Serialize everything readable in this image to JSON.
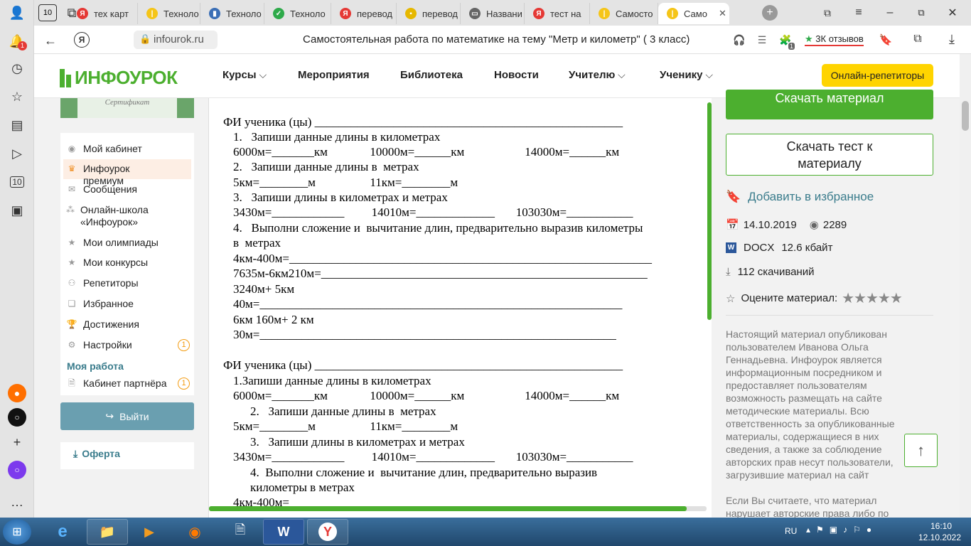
{
  "browser": {
    "tabs": [
      {
        "label": "тех карт",
        "icon": "yandex-icon",
        "color": "#e53935"
      },
      {
        "label": "Техноло",
        "icon": "infourok-tab-icon",
        "color": "#f5c518"
      },
      {
        "label": "Техноло",
        "icon": "book-icon",
        "color": "#3b6fb6"
      },
      {
        "label": "Техноло",
        "icon": "check-icon",
        "color": "#2eaa4a"
      },
      {
        "label": "перевод",
        "icon": "yandex-icon",
        "color": "#e53935"
      },
      {
        "label": "перевод",
        "icon": "image-icon",
        "color": "#e6b800"
      },
      {
        "label": "Названи",
        "icon": "doc-icon",
        "color": "#666666"
      },
      {
        "label": "тест на",
        "icon": "yandex-icon",
        "color": "#e53935"
      },
      {
        "label": "Самосто",
        "icon": "infourok-tab-icon",
        "color": "#f5c518"
      },
      {
        "label": "Само",
        "icon": "infourok-tab-icon",
        "color": "#f5c518"
      }
    ],
    "tab_count_badge": "10",
    "notif_badge": "1",
    "url": "infourok.ru",
    "page_title": "Самостоятельная работа по математике на тему \"Метр и километр\" ( 3 класс)",
    "reviews": "3К отзывов",
    "ext_badge": "1"
  },
  "site": {
    "logo": "ИНФОУРОК",
    "certificate_text": "Сертификат",
    "nav": [
      {
        "label": "Курсы",
        "dropdown": true
      },
      {
        "label": "Мероприятия",
        "dropdown": false
      },
      {
        "label": "Библиотека",
        "dropdown": false
      },
      {
        "label": "Новости",
        "dropdown": false
      },
      {
        "label": "Учителю",
        "dropdown": true
      },
      {
        "label": "Ученику",
        "dropdown": true
      }
    ],
    "tutors_button": "Онлайн-репетиторы",
    "accent": "#4caf2f",
    "tutors_color": "#ffd400"
  },
  "sidebar": {
    "items": [
      {
        "label": "Мой кабинет",
        "icon": "user-icon"
      },
      {
        "label": "Инфоурок премиум",
        "icon": "crown-icon"
      },
      {
        "label": "Сообщения",
        "icon": "mail-icon"
      },
      {
        "label": "Онлайн-школа «Инфоурок»",
        "icon": "school-icon"
      },
      {
        "label": "Мои олимпиады",
        "icon": "star-icon"
      },
      {
        "label": "Мои конкурсы",
        "icon": "star-icon"
      },
      {
        "label": "Репетиторы",
        "icon": "people-icon"
      },
      {
        "label": "Избранное",
        "icon": "bookmark-icon"
      },
      {
        "label": "Достижения",
        "icon": "trophy-icon"
      },
      {
        "label": "Настройки",
        "icon": "gear-icon",
        "badge": "1"
      }
    ],
    "section_title": "Моя работа",
    "partner": {
      "label": "Кабинет партнёра",
      "badge": "1"
    },
    "logout": "Выйти",
    "offer": "Оферта"
  },
  "document": {
    "lines": [
      "ФИ ученика (цы) ___________________________________________________",
      "1.   Запиши данные длины в километрах",
      "6000м=_______км              10000м=______км                    14000м=______км",
      "2.   Запиши данные длины в  метрах",
      "5км=________м                  11км=________м",
      "3.   Запиши длины в километрах и метрах",
      "3430м=____________         14010м=_____________       103030м=___________",
      "4.   Выполни сложение и  вычитание длин, предварительно выразив километры",
      "в  метрах",
      "4км-400м=____________________________________________________________",
      "7635м-6км210м=______________________________________________________",
      "3240м+ 5км",
      "40м=____________________________________________________________",
      "6км 160м+ 2 км",
      "30м=___________________________________________________________",
      "ФИ ученика (цы) ___________________________________________________",
      "1.Запиши данные длины в километрах",
      "6000м=_______км              10000м=______км                    14000м=______км",
      "2.   Запиши данные длины в  метрах",
      "5км=________м                  11км=________м",
      "3.   Запиши длины в километрах и метрах",
      "3430м=____________         14010м=_____________       103030м=___________",
      "4.  Выполни сложение и  вычитание длин, предварительно выразив",
      "километры в метрах",
      "4км-400м="
    ]
  },
  "right": {
    "download_button": "Скачать материал",
    "download_test": "Скачать тест к материалу",
    "favorite": "Добавить в избранное",
    "date": "14.10.2019",
    "views": "2289",
    "format": "DOCX",
    "size": "12.6 кбайт",
    "downloads": "112 скачиваний",
    "rate": "Оцените материал:",
    "disclaimer": "Настоящий материал опубликован пользователем Иванова Ольга Геннадьевна. Инфоурок является информационным посредником и предоставляет пользователям возможность размещать на сайте методические материалы. Всю ответственность за опубликованные материалы, содержащиеся в них сведения, а также за соблюдение авторских прав несут пользователи, загрузившие материал на сайт",
    "disclaimer2": "Если Вы считаете, что материал нарушает авторские права либо по"
  },
  "taskbar": {
    "lang": "RU",
    "time": "16:10",
    "date": "12.10.2022"
  }
}
